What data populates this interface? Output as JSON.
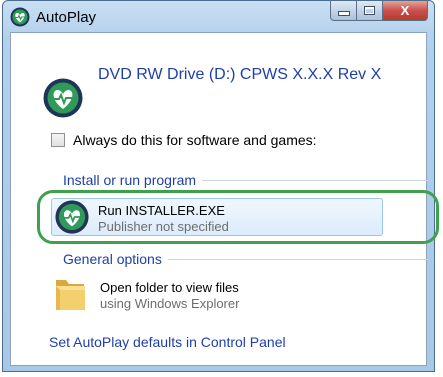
{
  "window": {
    "title": "AutoPlay",
    "controls": {
      "minimize_icon": "minimize-icon",
      "maximize_icon": "maximize-icon",
      "close_label": "X"
    }
  },
  "device": {
    "icon": "heart-pulse-icon",
    "title": "DVD RW Drive (D:) CPWS X.X.X Rev X"
  },
  "always_checkbox": {
    "label": "Always do this for software and games:",
    "checked": false
  },
  "sections": {
    "install": {
      "header": "Install or run program",
      "items": [
        {
          "icon": "heart-pulse-icon",
          "title": "Run INSTALLER.EXE",
          "subtitle": "Publisher not specified",
          "highlighted": true
        }
      ]
    },
    "general": {
      "header": "General options",
      "items": [
        {
          "icon": "folder-icon",
          "title": "Open folder to view files",
          "subtitle": "using Windows Explorer"
        }
      ]
    }
  },
  "footer": {
    "link": "Set AutoPlay defaults in Control Panel"
  },
  "colors": {
    "link_blue": "#1e3fa8",
    "brand_green": "#2f9a5a",
    "brand_navy": "#1f3557",
    "annotation_green": "#3fa050",
    "close_red": "#c75050"
  }
}
